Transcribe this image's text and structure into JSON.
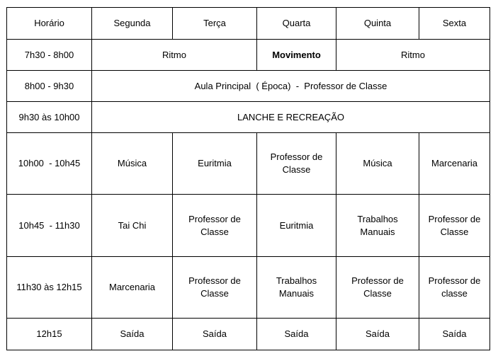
{
  "header": {
    "time": "Horário",
    "days": [
      "Segunda",
      "Terça",
      "Quarta",
      "Quinta",
      "Sexta"
    ]
  },
  "rows": {
    "r1": {
      "time": "7h30 - 8h00",
      "cells": [
        "Ritmo",
        "Movimento",
        "Ritmo"
      ]
    },
    "r2": {
      "time": "8h00 - 9h30",
      "cells": [
        "Aula Principal  ( Época)  -  Professor de Classe"
      ]
    },
    "r3": {
      "time": "9h30 às 10h00",
      "cells": [
        "LANCHE E RECREAÇÃO"
      ]
    },
    "r4": {
      "time": "10h00  - 10h45",
      "cells": [
        "Música",
        "Euritmia",
        "Professor de\nClasse",
        "Música",
        "Marcenaria"
      ]
    },
    "r5": {
      "time": "10h45  - 11h30",
      "cells": [
        "Tai Chi",
        "Professor de\nClasse",
        "Euritmia",
        "Trabalhos\nManuais",
        "Professor de\nClasse"
      ]
    },
    "r6": {
      "time": "11h30 às 12h15",
      "cells": [
        "Marcenaria",
        "Professor de\nClasse",
        "Trabalhos\nManuais",
        "Professor de\nClasse",
        "Professor de\nclasse"
      ]
    },
    "r7": {
      "time": "12h15",
      "cells": [
        "Saída",
        "Saída",
        "Saída",
        "Saída",
        "Saída"
      ]
    }
  }
}
